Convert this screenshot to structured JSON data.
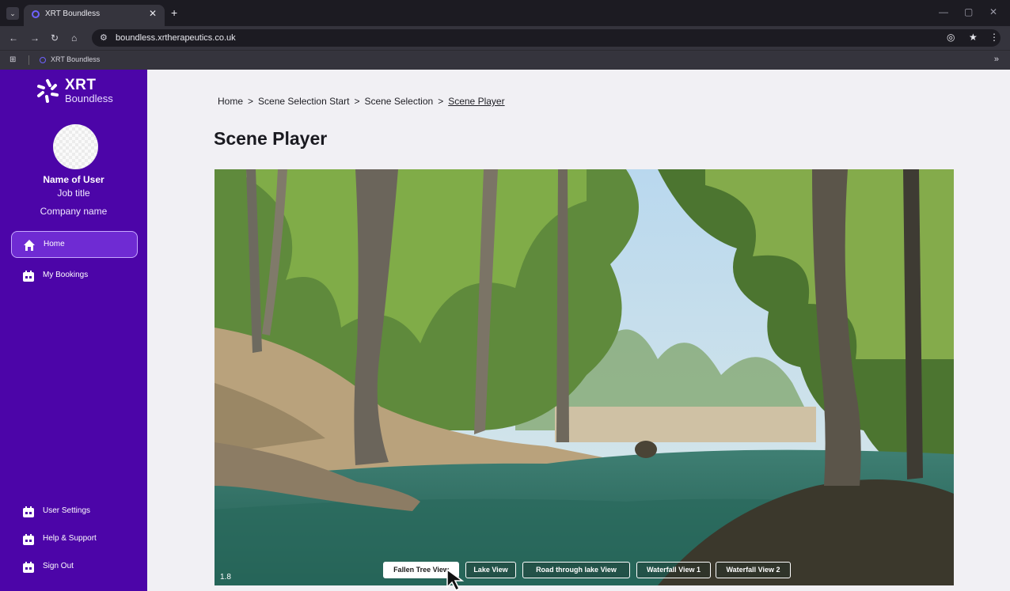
{
  "browser": {
    "tab_title": "XRT Boundless",
    "url": "boundless.xrtherapeutics.co.uk",
    "bookmark_label": "XRT Boundless"
  },
  "sidebar": {
    "logo_word": "XRT",
    "logo_sub": "Boundless",
    "user": {
      "name": "Name of User",
      "job_title": "Job title",
      "company": "Company name"
    },
    "nav_top": [
      {
        "label": "Home",
        "icon": "home-icon",
        "active": true
      },
      {
        "label": "My Bookings",
        "icon": "calendar-icon",
        "active": false
      }
    ],
    "nav_bottom": [
      {
        "label": "User Settings",
        "icon": "calendar-icon"
      },
      {
        "label": "Help & Support",
        "icon": "calendar-icon"
      },
      {
        "label": "Sign Out",
        "icon": "calendar-icon"
      }
    ]
  },
  "main": {
    "breadcrumb": [
      {
        "label": "Home"
      },
      {
        "label": "Scene Selection Start"
      },
      {
        "label": "Scene Selection"
      },
      {
        "label": "Scene Player"
      }
    ],
    "title": "Scene Player",
    "player": {
      "version": "1.8",
      "scene_buttons": [
        {
          "label": "Fallen Tree View",
          "active": true
        },
        {
          "label": "Lake View",
          "active": false
        },
        {
          "label": "Road through lake View",
          "active": false
        },
        {
          "label": "Waterfall View 1",
          "active": false
        },
        {
          "label": "Waterfall View 2",
          "active": false
        }
      ]
    }
  },
  "colors": {
    "sidebar_bg": "#4c05a8",
    "active_nav_bg": "#6f2bd3",
    "page_bg": "#f1f0f4"
  }
}
